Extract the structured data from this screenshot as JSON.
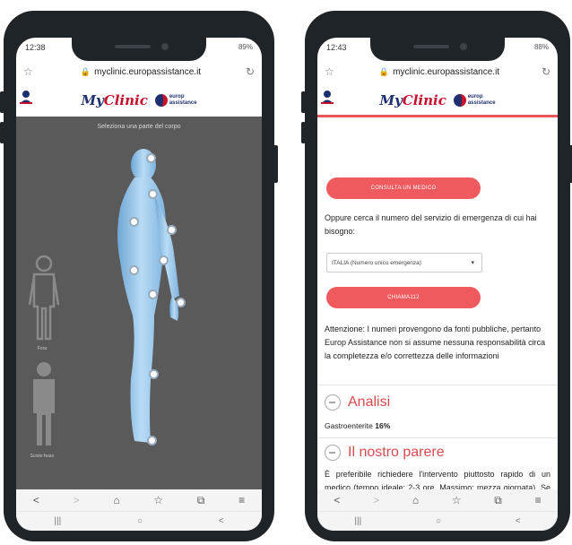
{
  "left": {
    "status": {
      "time": "12:38",
      "right": "89%"
    },
    "url": "myclinic.europassistance.it",
    "brand": {
      "my": "My",
      "clinic": "Clinic",
      "logo_line1": "europ",
      "logo_line2": "assistance"
    },
    "hint": "Seleziona una parte del corpo",
    "views": [
      {
        "label": "Fora"
      },
      {
        "label": "Scioto fearo"
      }
    ]
  },
  "right": {
    "status": {
      "time": "12:43",
      "right": "88%"
    },
    "url": "myclinic.europassistance.it",
    "brand": {
      "my": "My",
      "clinic": "Clinic",
      "logo_line1": "europ",
      "logo_line2": "assistance"
    },
    "consult_button": "CONSULTA UN MEDICO",
    "emergency_text": "Oppure cerca il numero del servizio di emergenza di cui hai bisogno:",
    "select_value": "ITALIA (Numero unico emergenza)",
    "call_button": "CHIAMA112",
    "disclaimer": "Attenzione: I numeri provengono da fonti pubbliche, pertanto Europ Assistance non si assume nessuna responsabilità circa la completezza e/o correttezza delle informazioni",
    "analisi_title": "Analisi",
    "analisi_label": "Gastroenterite",
    "analisi_value": "16%",
    "parere_title": "Il nostro parere",
    "parere_text": "È preferibile richiedere l'intervento piuttosto rapido di un medico (tempo ideale: 2-3 ore. Massimo: mezza giornata). Se il medico curante non è disponibile, chiamare la guardia medica."
  },
  "nav": {
    "back": "<",
    "forward": ">",
    "home": "⌂",
    "bookmark": "☆",
    "tabs": "⧉",
    "menu": "≡"
  },
  "sys": {
    "recent": "|||",
    "home": "○",
    "back": "<"
  },
  "colors": {
    "accent": "#ef5a5e",
    "brand_blue": "#1d2f6f",
    "map_bg": "#5a5a5a"
  }
}
